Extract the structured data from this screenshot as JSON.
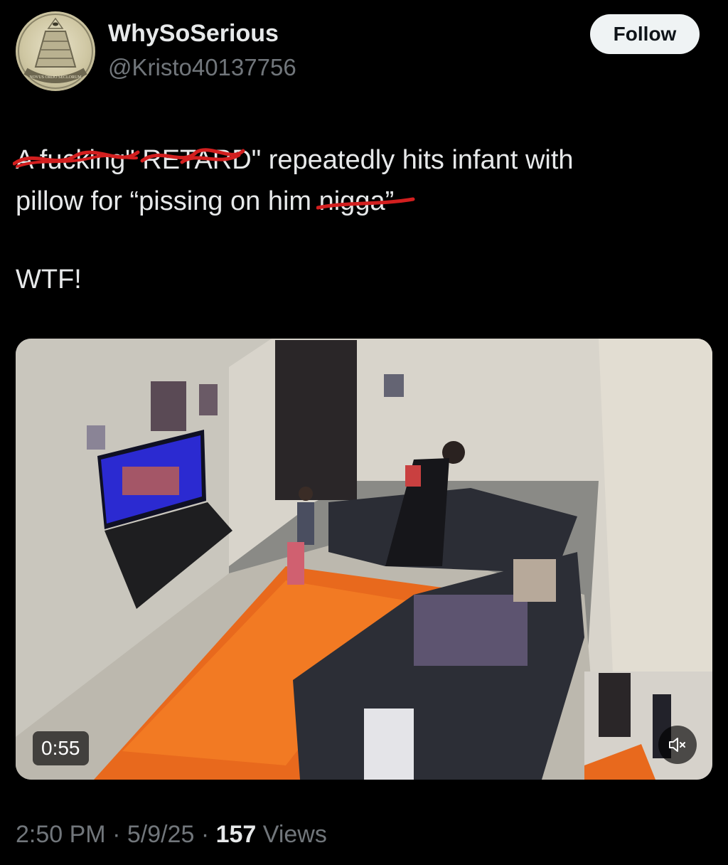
{
  "author": {
    "display_name": "WhySoSerious",
    "handle": "@Kristo40137756",
    "avatar_icon": "pyramid-seal-icon",
    "avatar_caption": "NOVUS ORDO SECLORUM"
  },
  "follow_label": "Follow",
  "tweet": {
    "line1_struck_1": "A fucking",
    "line1_mid": "\" ",
    "line1_struck_2": "RETARD",
    "line1_rest": "\" repeatedly hits infant with",
    "line2_start": "pillow for “pissing on him ",
    "line2_struck": "nigga",
    "line2_end": "”",
    "line3": "WTF!"
  },
  "video": {
    "duration": "0:55",
    "mute_icon": "speaker-muted-icon"
  },
  "meta": {
    "time": "2:50 PM",
    "sep1": " · ",
    "date": "5/9/25",
    "sep2": " · ",
    "views_count": "157",
    "views_label": " Views"
  },
  "colors": {
    "background": "#000000",
    "text": "#e7e9ea",
    "muted_text": "#71767b",
    "follow_bg": "#eff3f4",
    "scribble": "#d21f1f"
  }
}
